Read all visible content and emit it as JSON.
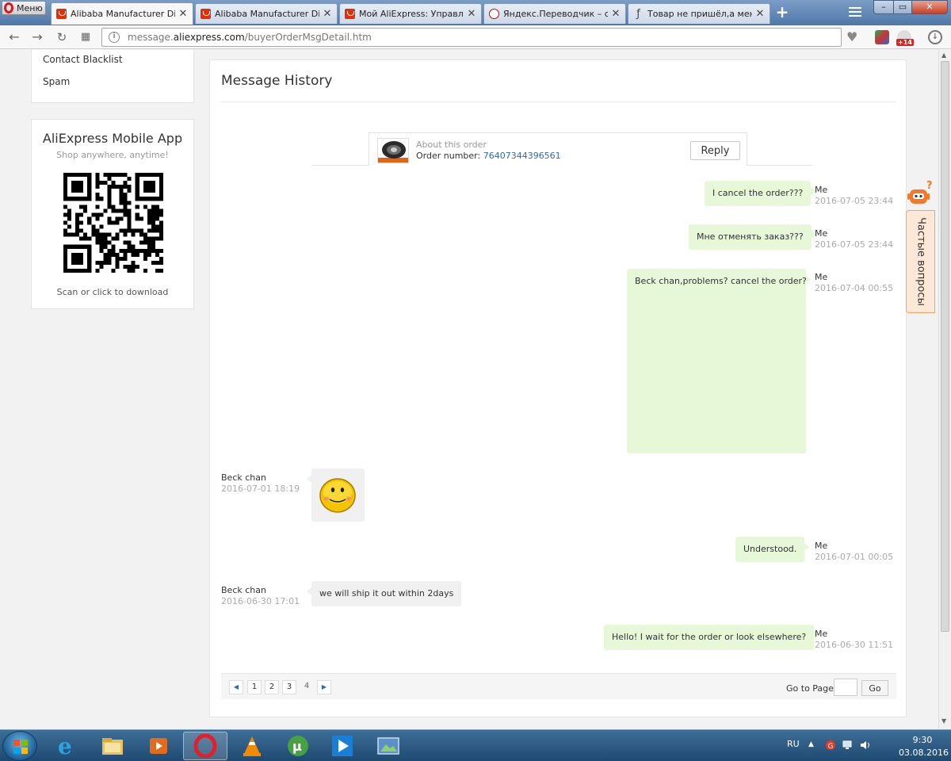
{
  "browser": {
    "menu_label": "Меню",
    "tabs": [
      {
        "label": "Alibaba Manufacturer Directo",
        "icon": "aliexpress-icon",
        "active": true
      },
      {
        "label": "Alibaba Manufacturer Directo",
        "icon": "aliexpress-icon",
        "active": false
      },
      {
        "label": "Мой AliExpress: Управлять з",
        "icon": "aliexpress-icon",
        "active": false
      },
      {
        "label": "Яндекс.Переводчик – слова",
        "icon": "yandex-icon",
        "active": false
      },
      {
        "label": "Товар не пришёл,а меня пр",
        "icon": "forum-icon",
        "active": false
      }
    ],
    "url_host": "message.aliexpress.com",
    "url_path": "/buyerOrderMsgDetail.htm",
    "url_prefix": "message.",
    "url_domain": "aliexpress.com",
    "extension_badge": "+14"
  },
  "sidebar": {
    "links": [
      "Contact Blacklist",
      "Spam"
    ],
    "app": {
      "title": "AliExpress Mobile App",
      "subtitle": "Shop anywhere, anytime!",
      "scan_text": "Scan or click to download"
    }
  },
  "main": {
    "title": "Message History",
    "order": {
      "about": "About this order",
      "number_label": "Order number: ",
      "number": "76407344396561",
      "reply_label": "Reply"
    },
    "messages": [
      {
        "side": "me",
        "sender": "Me",
        "time": "2016-07-05 23:44",
        "text": "I cancel the order???"
      },
      {
        "side": "me",
        "sender": "Me",
        "time": "2016-07-05 23:44",
        "text": "Мне отменять заказ???"
      },
      {
        "side": "me",
        "sender": "Me",
        "time": "2016-07-04 00:55",
        "text": "Beck chan,problems? cancel the order?"
      },
      {
        "side": "them",
        "sender": "Beck chan",
        "time": "2016-07-01 18:19",
        "text": "",
        "attachment": "smiley-icon"
      },
      {
        "side": "me",
        "sender": "Me",
        "time": "2016-07-01 00:05",
        "text": "Understood."
      },
      {
        "side": "them",
        "sender": "Beck chan",
        "time": "2016-06-30 17:01",
        "text": "we will ship it out within 2days"
      },
      {
        "side": "me",
        "sender": "Me",
        "time": "2016-06-30 11:51",
        "text": "Hello! I wait for the order or look elsewhere?"
      }
    ],
    "pagination": {
      "pages": [
        "1",
        "2",
        "3",
        "4"
      ],
      "current_page": "4",
      "goto_label": "Go to Page",
      "goto_value": "",
      "go_label": "Go"
    }
  },
  "faq_widget": {
    "label": "Частые вопросы"
  },
  "taskbar": {
    "apps": [
      "internet-explorer-icon",
      "file-explorer-icon",
      "media-player-icon",
      "opera-icon",
      "vlc-icon",
      "utorrent-icon",
      "play-icon",
      "screenshot-tool-icon"
    ],
    "active_app": "opera-icon",
    "language": "RU",
    "time": "9:30",
    "date": "03.08.2016"
  },
  "colors": {
    "accent_link": "#2e6ab1",
    "my_bubble": "#e7f8d9",
    "their_bubble": "#f0f0f0",
    "aliexpress_red": "#e62e04",
    "faq_orange": "#f2a271"
  }
}
